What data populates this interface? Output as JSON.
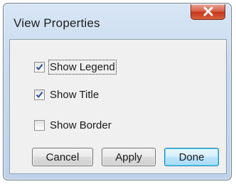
{
  "window": {
    "title": "View Properties"
  },
  "icons": {
    "close": "close-icon",
    "checkmark": "checkmark-icon"
  },
  "checkboxes": [
    {
      "label": "Show Legend",
      "checked": true,
      "focused": true
    },
    {
      "label": "Show Title",
      "checked": true,
      "focused": false
    },
    {
      "label": "Show Border",
      "checked": false,
      "focused": false
    }
  ],
  "buttons": {
    "cancel": "Cancel",
    "apply": "Apply",
    "done": "Done"
  },
  "colors": {
    "close_button": "#c6391d",
    "checkmark": "#2a4a9a",
    "default_button_border": "#3c7fb1"
  }
}
